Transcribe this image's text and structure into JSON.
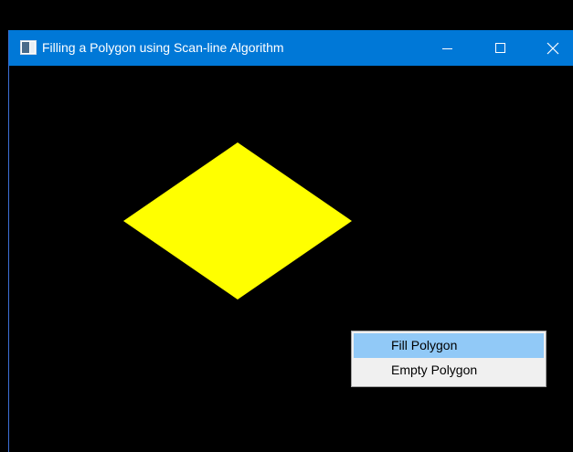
{
  "window": {
    "title": "Filling a Polygon using Scan-line Algorithm"
  },
  "caption_buttons": {
    "minimize_icon": "minimize-icon",
    "maximize_icon": "maximize-icon",
    "close_icon": "close-icon"
  },
  "canvas": {
    "background_color": "#000000",
    "polygon": {
      "shape": "diamond",
      "fill_color": "#ffff00"
    }
  },
  "context_menu": {
    "items": [
      {
        "label": "Fill Polygon",
        "highlighted": true
      },
      {
        "label": "Empty Polygon",
        "highlighted": false
      }
    ],
    "highlight_color": "#91c9f7"
  },
  "colors": {
    "titlebar": "#0078d7",
    "title_text": "#ffffff"
  }
}
